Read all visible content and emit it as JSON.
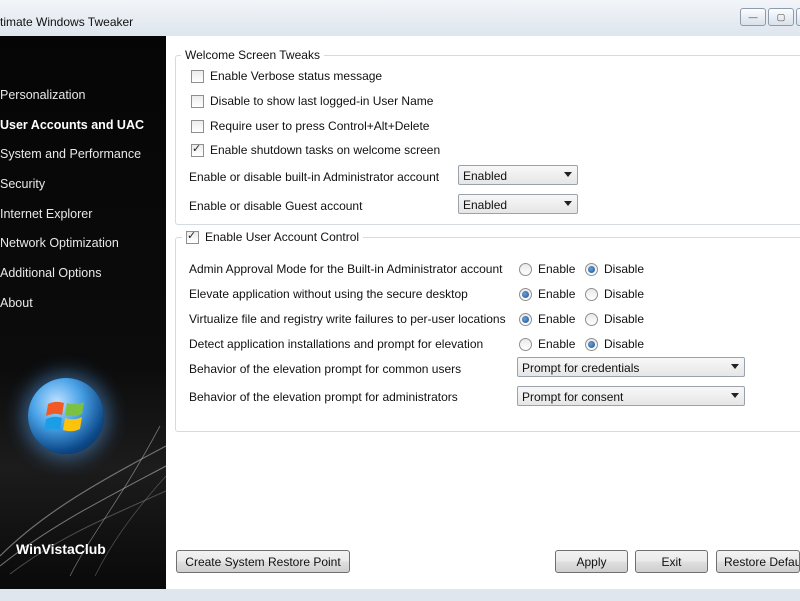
{
  "window": {
    "title": "timate Windows Tweaker",
    "minimize_glyph": "—",
    "maximize_glyph": "▢",
    "close_glyph": "✕"
  },
  "sidebar": {
    "items": [
      {
        "label": "Personalization",
        "active": false
      },
      {
        "label": "User Accounts and UAC",
        "active": true
      },
      {
        "label": "System and Performance",
        "active": false
      },
      {
        "label": "Security",
        "active": false
      },
      {
        "label": "Internet Explorer",
        "active": false
      },
      {
        "label": "Network Optimization",
        "active": false
      },
      {
        "label": "Additional Options",
        "active": false
      },
      {
        "label": "About",
        "active": false
      }
    ],
    "brand": "WinVistaClub"
  },
  "welcome": {
    "legend": "Welcome Screen Tweaks",
    "options": [
      {
        "label": "Enable Verbose status message",
        "checked": false
      },
      {
        "label": "Disable to show last logged-in User Name",
        "checked": false
      },
      {
        "label": "Require user to press Control+Alt+Delete",
        "checked": false
      },
      {
        "label": "Enable shutdown tasks on welcome screen",
        "checked": true
      }
    ],
    "admin_label": "Enable or disable built-in Administrator account",
    "admin_value": "Enabled",
    "guest_label": "Enable or disable Guest account",
    "guest_value": "Enabled"
  },
  "uac": {
    "legend": "Enable User Account Control",
    "checked": true,
    "enable_label": "Enable",
    "disable_label": "Disable",
    "rows": [
      {
        "label": "Admin Approval Mode for the Built-in Administrator account",
        "selected": "disable"
      },
      {
        "label": "Elevate application without using the secure desktop",
        "selected": "enable"
      },
      {
        "label": "Virtualize file and registry write failures to per-user locations",
        "selected": "enable"
      },
      {
        "label": "Detect application installations and prompt for elevation",
        "selected": "disable"
      }
    ],
    "common_label": "Behavior of the elevation prompt for common users",
    "common_value": "Prompt for credentials",
    "admins_label": "Behavior of the elevation prompt for administrators",
    "admins_value": "Prompt for consent"
  },
  "buttons": {
    "restore_point": "Create System Restore Point",
    "apply": "Apply",
    "exit": "Exit",
    "restore_defaults": "Restore Defaul"
  },
  "colors": {
    "sidebar_bg": "#0a0a0a",
    "frame": "#dfe6ee",
    "accent": "#1c4f8b"
  }
}
